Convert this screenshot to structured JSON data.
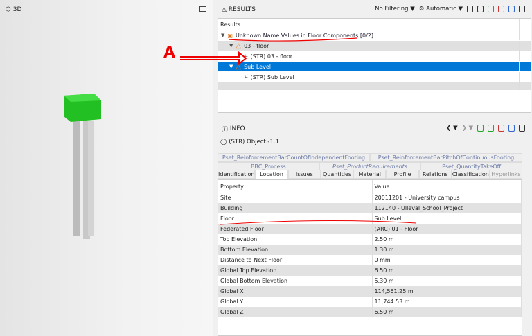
{
  "view3d": {
    "title": "3D"
  },
  "results": {
    "title": "RESULTS",
    "filter": "No Filtering",
    "mode": "Automatic",
    "column": "Results",
    "tree": [
      {
        "label": "Unknown Name Values in Floor Components [0/2]",
        "level": 0
      },
      {
        "label": "03 - floor",
        "level": 1
      },
      {
        "label": "(STR) 03 - floor",
        "level": 2
      },
      {
        "label": "Sub Level",
        "level": 1
      },
      {
        "label": "(STR) Sub Level",
        "level": 2
      }
    ]
  },
  "annotation": "A",
  "info": {
    "title": "INFO",
    "object": "(STR) Object.-1.1",
    "tabs_row1": [
      "Pset_ReinforcementBarCountOfIndependentFooting",
      "Pset_ReinforcementBarPitchOfContinuousFooting"
    ],
    "tabs_row2": [
      "BBC_Process",
      "Pset_ProductRequirements",
      "Pset_QuantityTakeOff"
    ],
    "tabs_row3": [
      "Identification",
      "Location",
      "Issues",
      "Quantities",
      "Material",
      "Profile",
      "Relations",
      "Classification",
      "Hyperlinks"
    ],
    "headers": [
      "Property",
      "Value"
    ],
    "rows": [
      [
        "Site",
        "20011201 - University campus"
      ],
      [
        "Building",
        "112140 - Ulleval_School_Project"
      ],
      [
        "Floor",
        "Sub Level"
      ],
      [
        "Federated Floor",
        "(ARC) 01 - Floor"
      ],
      [
        "Top Elevation",
        "2.50 m"
      ],
      [
        "Bottom Elevation",
        "1.30 m"
      ],
      [
        "Distance to Next Floor",
        "0 mm"
      ],
      [
        "Global Top Elevation",
        "6.50 m"
      ],
      [
        "Global Bottom Elevation",
        "5.30 m"
      ],
      [
        "Global X",
        "114,561.25 m"
      ],
      [
        "Global Y",
        "11,744.53 m"
      ],
      [
        "Global Z",
        "6.50 m"
      ]
    ]
  }
}
